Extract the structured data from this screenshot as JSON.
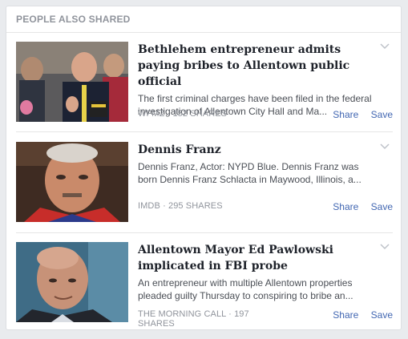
{
  "section": {
    "title": "PEOPLE ALSO SHARED"
  },
  "stories": [
    {
      "title": "Bethlehem entrepreneur admits paying bribes to Allentown public official",
      "description": "The first criminal charges have been filed in the federal investigation of Allentown City Hall and Ma...",
      "source": "WFMZ",
      "shares": "152 SHARES",
      "share_label": "Share",
      "save_label": "Save"
    },
    {
      "title": "Dennis Franz",
      "description": "Dennis Franz, Actor: NYPD Blue. Dennis Franz was born Dennis Franz Schlacta in Maywood, Illinois, a...",
      "source": "IMDB",
      "shares": "295 SHARES",
      "share_label": "Share",
      "save_label": "Save"
    },
    {
      "title": "Allentown Mayor Ed Pawlowski implicated in FBI probe",
      "description": "An entrepreneur with multiple Allentown properties pleaded guilty Thursday to conspiring to bribe an...",
      "source": "THE MORNING CALL",
      "shares": "197 SHARES",
      "share_label": "Share",
      "save_label": "Save"
    }
  ],
  "meta_separator": "·",
  "colors": {
    "link": "#4267b2",
    "muted": "#90949c",
    "title": "#1d2129"
  },
  "icons": {
    "menu": "chevron-down-icon"
  }
}
